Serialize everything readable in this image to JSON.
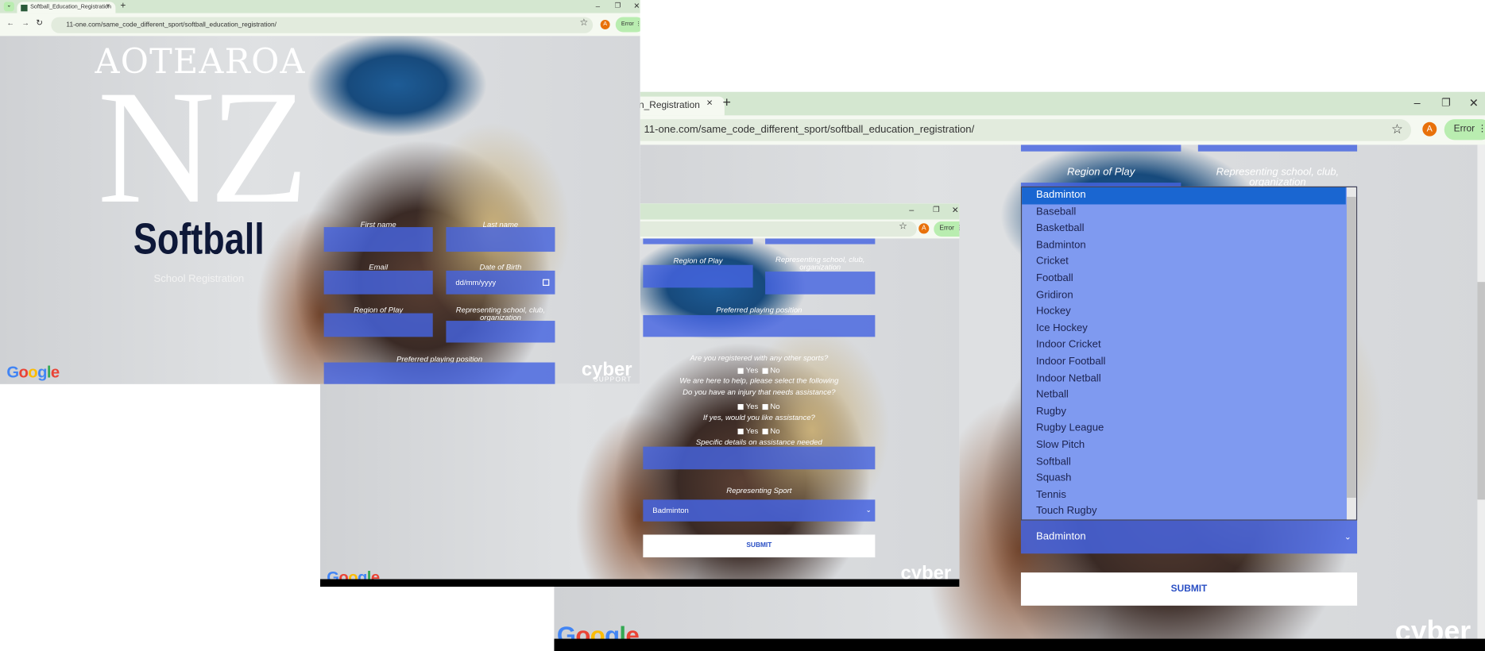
{
  "browser": {
    "tab_title": "Softball_Education_Registration",
    "url": "11-one.com/same_code_different_sport/softball_education_registration/",
    "error_label": "Error",
    "avatar_letter": "A",
    "new_tab": "+",
    "close_tab": "×",
    "minimize": "–",
    "restore": "❐",
    "close": "✕",
    "back": "←",
    "forward": "→",
    "reload": "↻",
    "star": "☆",
    "menu": "⋮"
  },
  "hero": {
    "line1": "AOTEAROA",
    "line2": "NZ",
    "sport": "Softball",
    "subtitle": "School Registration"
  },
  "form": {
    "first_name": "First name",
    "last_name": "Last name",
    "email": "Email",
    "dob": "Date of Birth",
    "dob_placeholder": "dd/mm/yyyy",
    "region": "Region of Play",
    "school": "Representing school, club, organization",
    "position": "Preferred playing position",
    "q_other_sports": "Are you registered with any other sports?",
    "help_text": "We are here to help, please select the following",
    "q_injury": "Do you have an injury that needs assistance?",
    "q_assist": "If yes, would you like assistance?",
    "details": "Specific details on assistance needed",
    "yes": "Yes",
    "no": "No",
    "sport_label": "Representing Sport",
    "sport_selected": "Badminton",
    "submit": "SUBMIT"
  },
  "sport_options": [
    "Badminton",
    "Baseball",
    "Basketball",
    "Badminton",
    "Cricket",
    "Football",
    "Gridiron",
    "Hockey",
    "Ice Hockey",
    "Indoor Cricket",
    "Indoor Football",
    "Indoor Netball",
    "Netball",
    "Rugby",
    "Rugby League",
    "Slow Pitch",
    "Softball",
    "Squash",
    "Tennis",
    "Touch Rugby"
  ],
  "logos": {
    "google": "Google",
    "cyber": "cyber",
    "cyber_sub": "SUPPORT"
  },
  "colors": {
    "field": "#4664e1",
    "dropdown_bg": "#7f9af0",
    "dropdown_selected": "#1a66d1",
    "tabbar": "#d4e7d0"
  }
}
